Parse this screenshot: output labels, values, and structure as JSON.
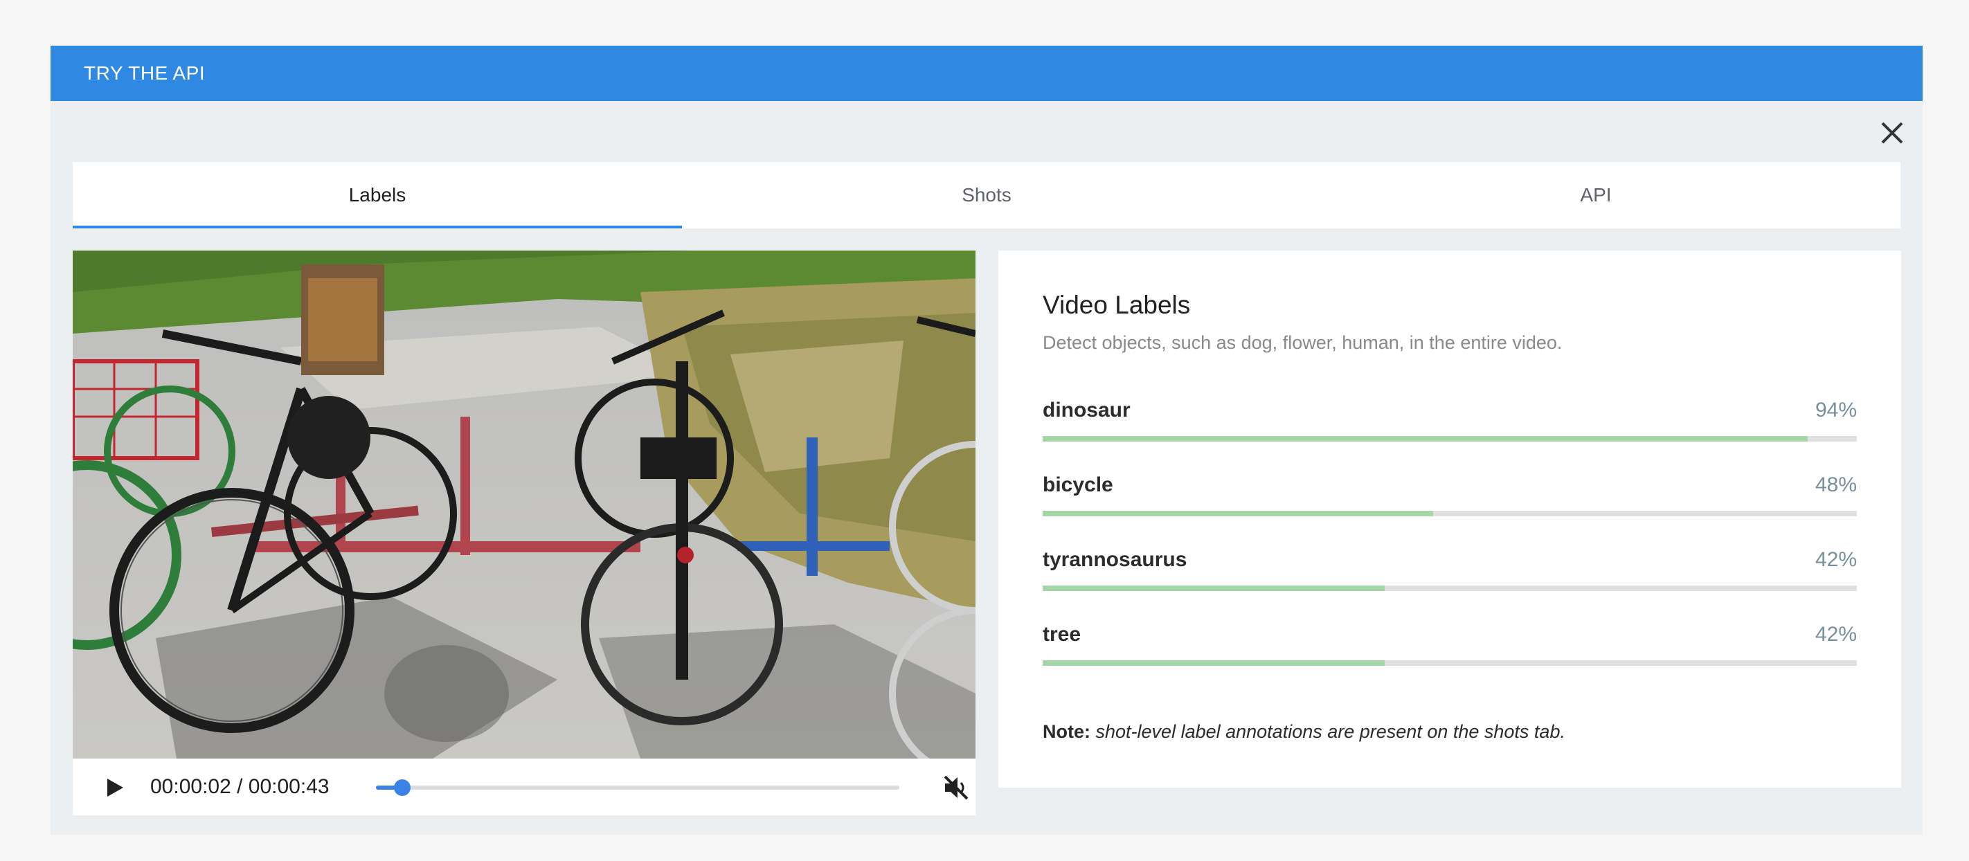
{
  "header": {
    "title": "TRY THE API"
  },
  "tabs": [
    {
      "label": "Labels",
      "active": true
    },
    {
      "label": "Shots",
      "active": false
    },
    {
      "label": "API",
      "active": false
    }
  ],
  "player": {
    "time_display": "00:00:02 / 00:00:43",
    "progress": 0.05,
    "muted": true
  },
  "labels_panel": {
    "title": "Video Labels",
    "subtitle": "Detect objects, such as dog, flower, human, in the entire video.",
    "items": [
      {
        "name": "dinosaur",
        "percent_text": "94%",
        "value": 0.94
      },
      {
        "name": "bicycle",
        "percent_text": "48%",
        "value": 0.48
      },
      {
        "name": "tyrannosaurus",
        "percent_text": "42%",
        "value": 0.42
      },
      {
        "name": "tree",
        "percent_text": "42%",
        "value": 0.42
      }
    ],
    "note_label": "Note:",
    "note_text": "shot-level label annotations are present on the shots tab."
  },
  "colors": {
    "header_blue": "#2f88e2",
    "accent_blue": "#3b82e6",
    "bar_green": "#a5d6a7"
  },
  "icons": [
    "close-icon",
    "play-icon",
    "volume-off-icon"
  ]
}
